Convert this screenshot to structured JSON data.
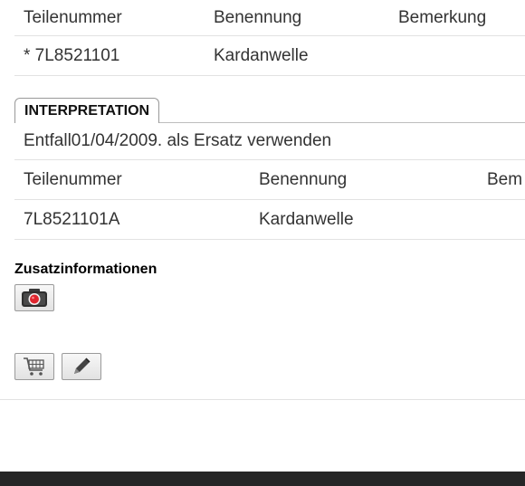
{
  "table1": {
    "headers": [
      "Teilenummer",
      "Benennung",
      "Bemerkung"
    ],
    "row": [
      "* 7L8521101",
      "Kardanwelle",
      ""
    ]
  },
  "interpretation": {
    "tab_label": "INTERPRETATION",
    "text": "Entfall01/04/2009. als Ersatz verwenden"
  },
  "table2": {
    "headers": [
      "Teilenummer",
      "Benennung",
      "Bem"
    ],
    "row": [
      "7L8521101A",
      "Kardanwelle",
      ""
    ]
  },
  "additional_info": {
    "title": "Zusatzinformationen"
  },
  "icons": {
    "camera": "camera-icon",
    "cart": "shopping-cart-icon",
    "edit": "pencil-icon"
  },
  "colors": {
    "footer": "#262626",
    "camera_lens": "#e0262f"
  }
}
